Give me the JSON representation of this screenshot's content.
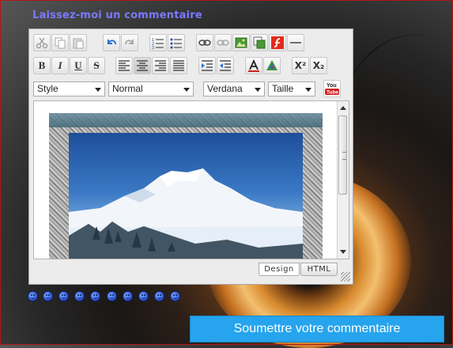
{
  "form": {
    "title": "Laissez-moi un commentaire",
    "submit_label": "Soumettre votre commentaire"
  },
  "editor": {
    "toolbar_row1": [
      "cut-icon",
      "copy-icon",
      "paste-icon",
      "undo-icon",
      "redo-icon",
      "ordered-list-icon",
      "unordered-list-icon",
      "link-icon",
      "unlink-icon",
      "image-icon",
      "image-manager-icon",
      "flash-icon",
      "horizontal-rule-icon"
    ],
    "toolbar_row2": {
      "bold": "B",
      "italic": "I",
      "underline": "U",
      "strike": "S",
      "superscript": "X²",
      "subscript": "X₂"
    },
    "selects": {
      "style": "Style",
      "format": "Normal",
      "font": "Verdana",
      "size": "Taille"
    },
    "youtube_label": "You Tube",
    "tabs": {
      "design": "Design",
      "html": "HTML",
      "active": "Design"
    }
  },
  "colors": {
    "title": "#7a7aff",
    "submit_bg": "#26a4ee",
    "smiley": "#2a55d8"
  },
  "smileys": [
    "smile",
    "grin",
    "wink",
    "laugh",
    "cool",
    "surprised",
    "sad",
    "tongue",
    "blush",
    "angry"
  ]
}
